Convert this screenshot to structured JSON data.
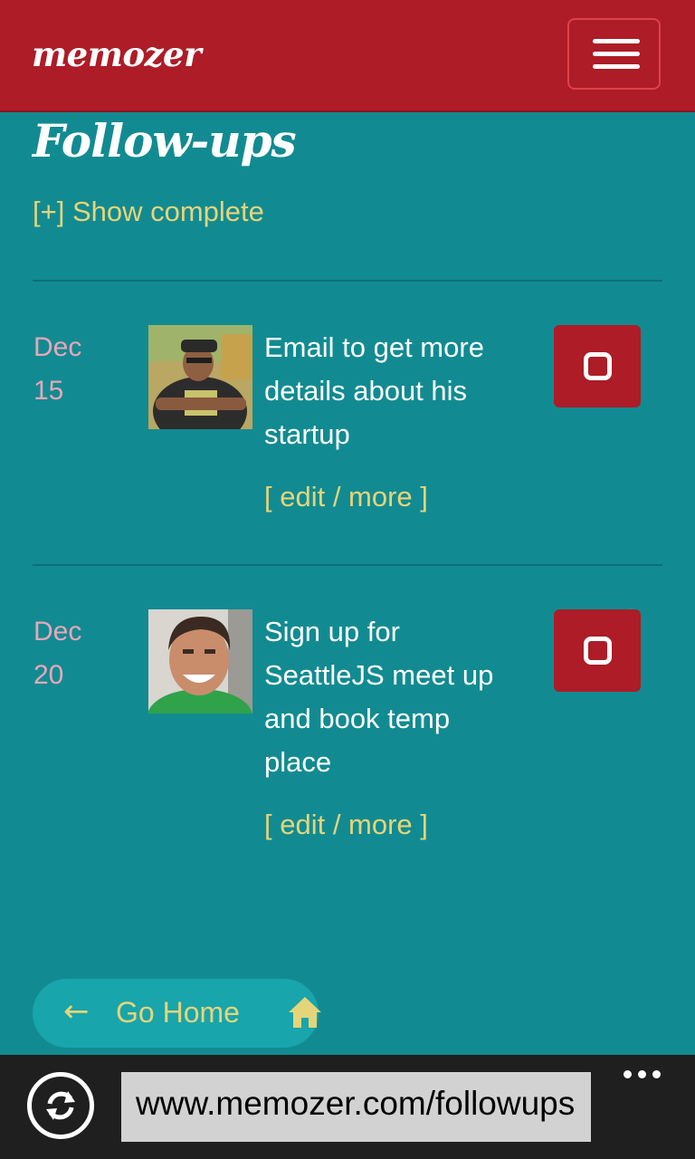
{
  "navbar": {
    "brand": "memozer",
    "menu_icon": "hamburger-icon"
  },
  "page": {
    "title": "Follow-ups",
    "show_complete": "[+] Show complete"
  },
  "followups": [
    {
      "month": "Dec",
      "day": "15",
      "text": "Email to get more details about his startup",
      "edit_link": "[ edit / more ]",
      "avatar_icon": "contact-photo",
      "checkbox_icon": "checkbox-icon"
    },
    {
      "month": "Dec",
      "day": "20",
      "text": "Sign up for SeattleJS meet up and book temp place",
      "edit_link": "[ edit / more ]",
      "avatar_icon": "contact-photo",
      "checkbox_icon": "checkbox-icon"
    }
  ],
  "home_button": {
    "arrow": "←",
    "label": "Go Home",
    "icon": "home-icon"
  },
  "browser": {
    "url": "www.memozer.com/followups",
    "refresh_icon": "refresh-icon",
    "more_icon": "more-dots-icon"
  },
  "colors": {
    "brand_red": "#ad1c27",
    "background_teal": "#118b91",
    "link_yellow": "#e6d47a",
    "date_pink": "#e7a7b9"
  }
}
